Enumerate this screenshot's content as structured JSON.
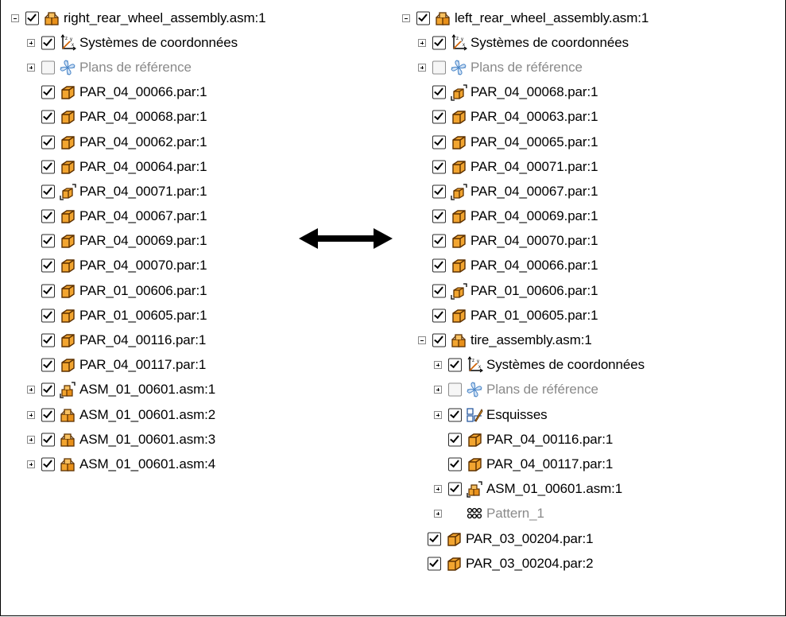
{
  "left_tree": {
    "root": {
      "label": "right_rear_wheel_assembly.asm:1",
      "expanded": true,
      "checked": true,
      "icon": "assembly-icon"
    },
    "items": [
      {
        "label": "Systèmes de coordonnées",
        "expander": "plus",
        "checked": true,
        "icon": "coordinate-system-icon"
      },
      {
        "label": "Plans de référence",
        "expander": "plus",
        "checked": false,
        "icon": "reference-plane-icon",
        "dim": true
      },
      {
        "label": "PAR_04_00066.par:1",
        "checked": true,
        "icon": "part-icon"
      },
      {
        "label": "PAR_04_00068.par:1",
        "checked": true,
        "icon": "part-icon"
      },
      {
        "label": "PAR_04_00062.par:1",
        "checked": true,
        "icon": "part-icon"
      },
      {
        "label": "PAR_04_00064.par:1",
        "checked": true,
        "icon": "part-icon"
      },
      {
        "label": "PAR_04_00071.par:1",
        "checked": true,
        "icon": "part-link-icon"
      },
      {
        "label": "PAR_04_00067.par:1",
        "checked": true,
        "icon": "part-icon"
      },
      {
        "label": "PAR_04_00069.par:1",
        "checked": true,
        "icon": "part-icon"
      },
      {
        "label": "PAR_04_00070.par:1",
        "checked": true,
        "icon": "part-icon"
      },
      {
        "label": "PAR_01_00606.par:1",
        "checked": true,
        "icon": "part-icon"
      },
      {
        "label": "PAR_01_00605.par:1",
        "checked": true,
        "icon": "part-icon"
      },
      {
        "label": "PAR_04_00116.par:1",
        "checked": true,
        "icon": "part-icon"
      },
      {
        "label": "PAR_04_00117.par:1",
        "checked": true,
        "icon": "part-icon"
      },
      {
        "label": "ASM_01_00601.asm:1",
        "expander": "plus",
        "checked": true,
        "icon": "assembly-link-icon"
      },
      {
        "label": "ASM_01_00601.asm:2",
        "expander": "plus",
        "checked": true,
        "icon": "assembly-icon"
      },
      {
        "label": "ASM_01_00601.asm:3",
        "expander": "plus",
        "checked": true,
        "icon": "assembly-icon"
      },
      {
        "label": "ASM_01_00601.asm:4",
        "expander": "plus",
        "checked": true,
        "icon": "assembly-icon"
      }
    ]
  },
  "right_tree": {
    "root": {
      "label": "left_rear_wheel_assembly.asm:1",
      "expanded": true,
      "checked": true,
      "icon": "assembly-icon"
    },
    "items": [
      {
        "label": "Systèmes de coordonnées",
        "expander": "plus",
        "checked": true,
        "icon": "coordinate-system-icon"
      },
      {
        "label": "Plans de référence",
        "expander": "plus",
        "checked": false,
        "icon": "reference-plane-icon",
        "dim": true
      },
      {
        "label": "PAR_04_00068.par:1",
        "checked": true,
        "icon": "part-link-icon"
      },
      {
        "label": "PAR_04_00063.par:1",
        "checked": true,
        "icon": "part-icon"
      },
      {
        "label": "PAR_04_00065.par:1",
        "checked": true,
        "icon": "part-icon"
      },
      {
        "label": "PAR_04_00071.par:1",
        "checked": true,
        "icon": "part-icon"
      },
      {
        "label": "PAR_04_00067.par:1",
        "checked": true,
        "icon": "part-link-icon"
      },
      {
        "label": "PAR_04_00069.par:1",
        "checked": true,
        "icon": "part-icon"
      },
      {
        "label": "PAR_04_00070.par:1",
        "checked": true,
        "icon": "part-icon"
      },
      {
        "label": "PAR_04_00066.par:1",
        "checked": true,
        "icon": "part-icon"
      },
      {
        "label": "PAR_01_00606.par:1",
        "checked": true,
        "icon": "part-link-icon"
      },
      {
        "label": "PAR_01_00605.par:1",
        "checked": true,
        "icon": "part-icon"
      },
      {
        "label": "tire_assembly.asm:1",
        "expander": "minus",
        "checked": true,
        "icon": "assembly-icon",
        "children": [
          {
            "label": "Systèmes de coordonnées",
            "expander": "plus",
            "checked": true,
            "icon": "coordinate-system-icon"
          },
          {
            "label": "Plans de référence",
            "expander": "plus",
            "checked": false,
            "icon": "reference-plane-icon",
            "dim": true
          },
          {
            "label": "Esquisses",
            "expander": "plus",
            "checked": true,
            "icon": "sketch-icon"
          },
          {
            "label": "PAR_04_00116.par:1",
            "checked": true,
            "icon": "part-icon"
          },
          {
            "label": "PAR_04_00117.par:1",
            "checked": true,
            "icon": "part-icon"
          },
          {
            "label": "ASM_01_00601.asm:1",
            "expander": "plus",
            "checked": true,
            "icon": "assembly-link-icon"
          },
          {
            "label": "Pattern_1",
            "expander": "plus",
            "checked": null,
            "icon": "pattern-icon",
            "dim": true
          }
        ]
      }
    ],
    "trailing_items": [
      {
        "label": "PAR_03_00204.par:1",
        "checked": true,
        "icon": "part-icon"
      },
      {
        "label": "PAR_03_00204.par:2",
        "checked": true,
        "icon": "part-icon"
      }
    ]
  },
  "colors": {
    "icon_orange": "#f0a020",
    "icon_outline": "#6a3a00",
    "dim_text": "#8a8a8a",
    "plane_blue": "#4a86c8"
  }
}
